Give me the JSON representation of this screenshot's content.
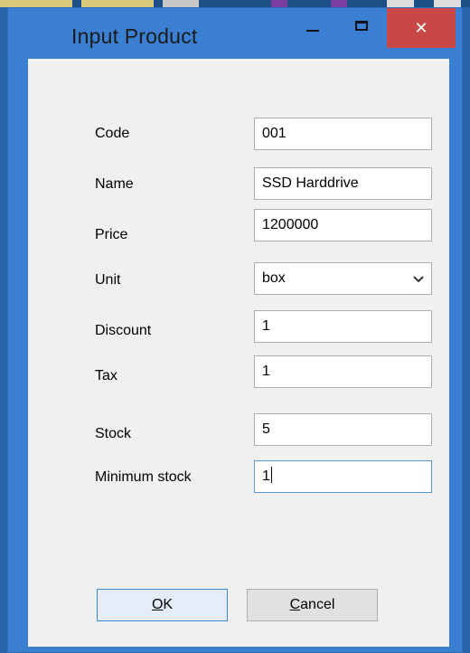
{
  "window": {
    "title": "Input Product",
    "close_glyph": "✕"
  },
  "form": {
    "code": {
      "label": "Code",
      "value": "001"
    },
    "name": {
      "label": "Name",
      "value": "SSD Harddrive"
    },
    "price": {
      "label": "Price",
      "value": "1200000"
    },
    "unit": {
      "label": "Unit",
      "value": "box"
    },
    "discount": {
      "label": "Discount",
      "value": "1"
    },
    "tax": {
      "label": "Tax",
      "value": "1"
    },
    "stock": {
      "label": "Stock",
      "value": "5"
    },
    "min_stock": {
      "label": "Minimum stock",
      "value": "1"
    }
  },
  "buttons": {
    "ok": {
      "mnemonic": "O",
      "rest": "K"
    },
    "cancel": {
      "mnemonic": "C",
      "rest": "ancel"
    }
  },
  "colors": {
    "titlebar": "#3a7fd1",
    "close": "#c94747",
    "client": "#f0f0f0"
  }
}
